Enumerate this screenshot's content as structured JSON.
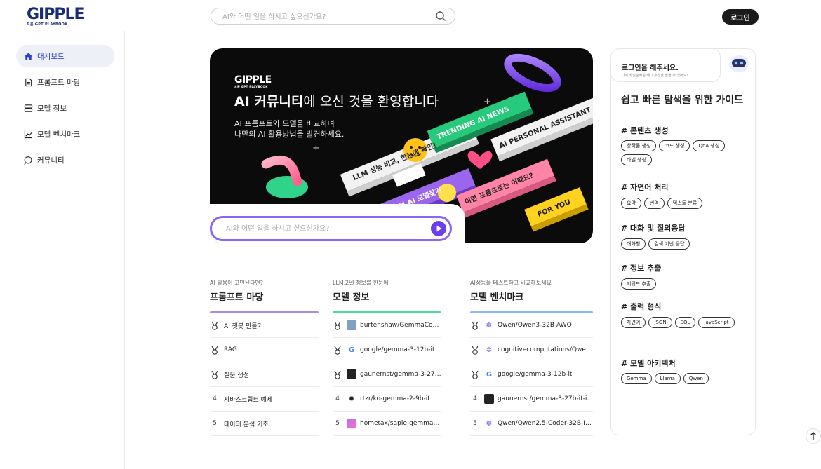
{
  "header": {
    "logo_text": "GIPPLE",
    "logo_sub": "프롬 GPT PLAYBOOK",
    "search_placeholder": "AI와 어떤 일을 하시고 싶으신가요?",
    "login_label": "로그인"
  },
  "sidebar": {
    "items": [
      {
        "label": "대시보드",
        "icon": "home-icon"
      },
      {
        "label": "프롬프트 마당",
        "icon": "document-icon"
      },
      {
        "label": "모델 정보",
        "icon": "server-icon"
      },
      {
        "label": "모델 벤치마크",
        "icon": "chart-icon"
      },
      {
        "label": "커뮤니티",
        "icon": "chat-icon"
      }
    ]
  },
  "hero": {
    "logo_text": "GIPPLE",
    "logo_sub": "프롬 GPT PLAYBOOK",
    "title_bold": "AI 커뮤니티",
    "title_rest": "에 오신 것을 환영합니다",
    "desc_line1": "AI 프롬프트와 모델을 비교하며",
    "desc_line2": "나만의 AI 활용방법을 발견하세요.",
    "banners": [
      "LLM 성능 비교, 한눈에 확인!",
      "TRENDING AI NEWS",
      "AI PERSONAL ASSISTANT",
      "최고의 AI 모델찾기",
      "이런 프롬프트는 어때요?",
      "FOR YOU"
    ],
    "search_placeholder": "AI와 어떤 일을 하시고 싶으신가요?"
  },
  "columns": [
    {
      "sub": "AI 활용이 고민된다면?",
      "head": "프롬프트 마당",
      "accent": "#a98ee8",
      "rows": [
        {
          "rank": "",
          "medal": "gold",
          "text": "AI 챗봇 만들기"
        },
        {
          "rank": "",
          "medal": "silver",
          "text": "RAG"
        },
        {
          "rank": "",
          "medal": "bronze",
          "text": "질문 생성"
        },
        {
          "rank": "4",
          "text": "자바스크립트 예제"
        },
        {
          "rank": "5",
          "text": "데이터 분석 기초"
        }
      ]
    },
    {
      "sub": "LLM모델 정보를 한눈에",
      "head": "모델 정보",
      "accent": "#4dd9a0",
      "rows": [
        {
          "rank": "",
          "medal": "gold",
          "logo": "avatar",
          "text": "burtenshaw/GemmaCoder3-..."
        },
        {
          "rank": "",
          "medal": "silver",
          "logo": "google",
          "text": "google/gemma-3-12b-it"
        },
        {
          "rank": "",
          "medal": "bronze",
          "logo": "dark",
          "text": "gaunernst/gemma-3-27b-it-i..."
        },
        {
          "rank": "4",
          "logo": "gear",
          "text": "rtzr/ko-gemma-2-9b-it"
        },
        {
          "rank": "5",
          "logo": "gradient",
          "text": "hometax/sapie-gemma2-9B..."
        }
      ]
    },
    {
      "sub": "AI성능을 테스트하고 비교해보세요",
      "head": "모델 벤치마크",
      "accent": "#8ab6f5",
      "rows": [
        {
          "rank": "",
          "medal": "gold",
          "logo": "qwen",
          "text": "Qwen/Qwen3-32B-AWQ"
        },
        {
          "rank": "",
          "medal": "silver",
          "logo": "qwen",
          "text": "cognitivecomputations/Qwen..."
        },
        {
          "rank": "",
          "medal": "bronze",
          "logo": "google",
          "text": "google/gemma-3-12b-it"
        },
        {
          "rank": "4",
          "logo": "dark",
          "text": "gaunernst/gemma-3-27b-it-i..."
        },
        {
          "rank": "5",
          "logo": "qwen",
          "text": "Qwen/Qwen2.5-Coder-32B-In..."
        }
      ]
    }
  ],
  "login_card": {
    "title": "로그인을 해주세요.",
    "subtitle": "나에게 맞춤화된 태그 추천을 받을 수 있어요!"
  },
  "guide": {
    "title": "쉽고 빠른 탐색을 위한 가이드",
    "sections": [
      {
        "title": "# 콘텐츠 생성",
        "chips": [
          "창작물 생성",
          "코드 생성",
          "QnA 생성",
          "라벨 생성"
        ]
      },
      {
        "title": "# 자연어 처리",
        "chips": [
          "요약",
          "번역",
          "텍스트 분류"
        ]
      },
      {
        "title": "# 대화 및 질의응답",
        "chips": [
          "대화형",
          "검색 기반 응답"
        ]
      },
      {
        "title": "# 정보 추출",
        "chips": [
          "키워드 추출"
        ]
      },
      {
        "title": "# 출력 형식",
        "chips": [
          "자연어",
          "JSON",
          "SQL",
          "JavaScript"
        ]
      },
      {
        "title": "# 모델 아키텍처",
        "chips": [
          "Gemma",
          "Llama",
          "Qwen"
        ]
      }
    ]
  }
}
